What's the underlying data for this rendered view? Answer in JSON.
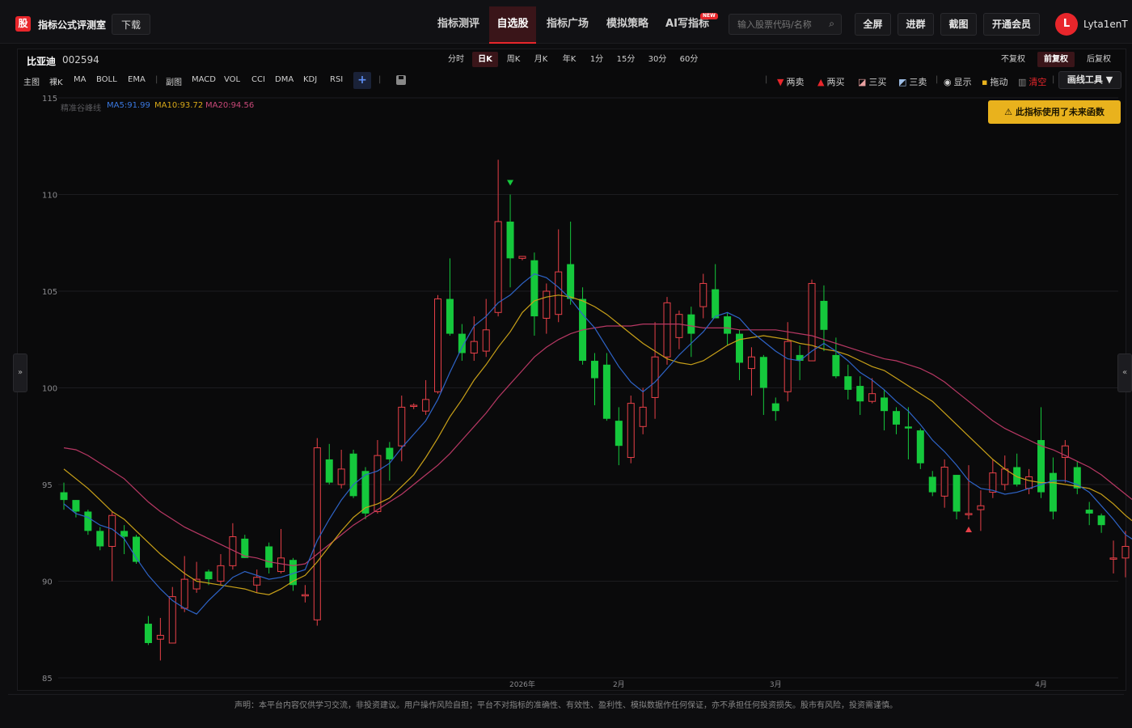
{
  "brand": {
    "logo_char": "股",
    "name": "指标公式评测室"
  },
  "header": {
    "download_label": "下载",
    "nav_tabs": [
      {
        "label": "指标测评"
      },
      {
        "label": "自选股"
      },
      {
        "label": "指标广场"
      },
      {
        "label": "模拟策略"
      },
      {
        "label": "AI写指标"
      }
    ],
    "active_tab": "自选股",
    "new_badge": "NEW",
    "search": {
      "placeholder": "输入股票代码/名称",
      "value": ""
    },
    "buttons": {
      "fullscreen": "全屏",
      "join_group": "进群",
      "screenshot": "截图",
      "vip": "开通会员"
    },
    "user": {
      "avatar_char": "L",
      "name": "Lyta1enT"
    },
    "accent_color": "#e8262b"
  },
  "stock": {
    "name": "比亚迪",
    "code": "002594"
  },
  "periods": [
    "分时",
    "日K",
    "周K",
    "月K",
    "年K",
    "1分",
    "15分",
    "30分",
    "60分"
  ],
  "active_period": "日K",
  "adjustments": [
    "不复权",
    "前复权",
    "后复权"
  ],
  "active_adjustment": "前复权",
  "indicators": {
    "main_label": "主图",
    "main": [
      "裸K",
      "MA",
      "BOLL",
      "EMA"
    ],
    "sub_label": "副图",
    "sub": [
      "MACD",
      "VOL",
      "CCI",
      "DMA",
      "KDJ",
      "RSI"
    ],
    "add": "+"
  },
  "tools": {
    "two_sell": "两卖",
    "two_buy": "两买",
    "three_buy": "三买",
    "three_sell": "三卖",
    "show": "显示",
    "drag": "拖动",
    "clear": "清空",
    "draw_tools": "画线工具",
    "warning": "此指标使用了未来函数"
  },
  "side_tabs": {
    "left": "»",
    "right": "«"
  },
  "footer": "声明：本平台内容仅供学习交流，非投资建议。用户操作风险自担；平台不对指标的准确性、有效性、盈利性、模拟数据作任何保证，亦不承担任何投资损失。股市有风险，投资需谨慎。",
  "chart_data": {
    "type": "candlestick",
    "ylim": [
      85,
      115
    ],
    "y_ticks": [
      85,
      90,
      95,
      100,
      105,
      110,
      115
    ],
    "x_labels": [
      {
        "label": "2026年",
        "index": 38
      },
      {
        "label": "2月",
        "index": 46
      },
      {
        "label": "3月",
        "index": 59
      },
      {
        "label": "4月",
        "index": 81
      }
    ],
    "ma_legend": {
      "name": "精准谷峰线",
      "ma5": "MA5:91.99",
      "ma10": "MA10:93.72",
      "ma20": "MA20:94.56"
    },
    "colors": {
      "up": "#e84048",
      "down": "#15c83c",
      "ma5": "#2e64c8",
      "ma10": "#c8a018",
      "ma20": "#b83864",
      "grid": "#1c1c20"
    },
    "candles": [
      [
        94.6,
        94.2,
        95.1,
        93.7
      ],
      [
        94.2,
        93.6,
        94.2,
        93.3
      ],
      [
        93.6,
        92.6,
        93.7,
        92.4
      ],
      [
        92.6,
        91.8,
        92.8,
        91.6
      ],
      [
        91.8,
        93.4,
        93.6,
        90.0
      ],
      [
        92.6,
        92.3,
        92.9,
        91.4
      ],
      [
        92.3,
        91.0,
        92.4,
        90.9
      ],
      [
        87.8,
        86.8,
        88.2,
        86.7
      ],
      [
        87.0,
        87.2,
        88.1,
        85.9
      ],
      [
        86.8,
        89.2,
        89.7,
        86.8
      ],
      [
        88.6,
        90.1,
        91.3,
        88.4
      ],
      [
        89.6,
        90.1,
        91.0,
        89.4
      ],
      [
        90.5,
        90.1,
        90.6,
        89.8
      ],
      [
        90.0,
        90.8,
        91.4,
        89.8
      ],
      [
        90.8,
        92.3,
        93.0,
        90.6
      ],
      [
        92.2,
        91.2,
        92.4,
        91.2
      ],
      [
        89.8,
        90.2,
        90.6,
        89.4
      ],
      [
        91.8,
        90.7,
        92.0,
        90.4
      ],
      [
        90.5,
        91.2,
        92.7,
        90.4
      ],
      [
        91.1,
        89.8,
        91.2,
        89.5
      ],
      [
        89.3,
        89.3,
        89.8,
        88.9
      ],
      [
        88.0,
        96.9,
        97.4,
        87.7
      ],
      [
        96.3,
        95.1,
        97.1,
        95.0
      ],
      [
        95.0,
        95.8,
        96.8,
        94.8
      ],
      [
        96.6,
        94.4,
        96.8,
        94.3
      ],
      [
        95.7,
        93.5,
        95.9,
        93.2
      ],
      [
        93.6,
        96.5,
        97.3,
        93.5
      ],
      [
        96.9,
        96.3,
        97.2,
        95.2
      ],
      [
        97.0,
        99.0,
        99.6,
        96.2
      ],
      [
        99.1,
        99.1,
        99.2,
        98.9
      ],
      [
        98.8,
        99.4,
        100.4,
        98.6
      ],
      [
        99.8,
        104.6,
        104.8,
        99.7
      ],
      [
        104.6,
        102.8,
        106.7,
        102.7
      ],
      [
        102.8,
        101.8,
        103.3,
        101.4
      ],
      [
        101.8,
        102.4,
        103.7,
        101.4
      ],
      [
        101.9,
        103.0,
        104.6,
        101.6
      ],
      [
        103.9,
        108.6,
        111.8,
        103.7
      ],
      [
        108.6,
        106.7,
        110.0,
        105.2
      ],
      [
        106.7,
        106.8,
        106.8,
        106.6
      ],
      [
        106.6,
        103.7,
        107.0,
        102.7
      ],
      [
        103.6,
        105.0,
        105.4,
        102.8
      ],
      [
        103.8,
        106.0,
        108.2,
        103.4
      ],
      [
        106.4,
        104.6,
        108.6,
        104.3
      ],
      [
        104.6,
        101.4,
        105.2,
        101.2
      ],
      [
        101.4,
        100.5,
        101.8,
        99.1
      ],
      [
        101.2,
        98.4,
        101.8,
        98.3
      ],
      [
        98.3,
        97.0,
        99.0,
        96.0
      ],
      [
        96.4,
        99.2,
        99.6,
        96.1
      ],
      [
        98.0,
        99.0,
        100.0,
        97.6
      ],
      [
        99.5,
        101.6,
        103.4,
        98.4
      ],
      [
        101.6,
        104.4,
        104.7,
        101.2
      ],
      [
        102.6,
        103.8,
        104.0,
        102.0
      ],
      [
        103.8,
        102.8,
        104.2,
        101.6
      ],
      [
        104.2,
        105.4,
        105.9,
        103.6
      ],
      [
        105.1,
        103.6,
        106.4,
        103.6
      ],
      [
        103.7,
        102.8,
        103.9,
        102.2
      ],
      [
        102.8,
        101.3,
        103.0,
        100.4
      ],
      [
        101.0,
        101.6,
        102.1,
        99.6
      ],
      [
        101.6,
        100.0,
        101.7,
        98.6
      ],
      [
        99.2,
        98.8,
        99.5,
        98.3
      ],
      [
        99.8,
        102.4,
        103.4,
        99.3
      ],
      [
        101.7,
        101.4,
        102.2,
        100.4
      ],
      [
        101.4,
        105.4,
        105.6,
        101.4
      ],
      [
        104.5,
        103.0,
        105.3,
        101.9
      ],
      [
        101.7,
        100.6,
        102.6,
        100.5
      ],
      [
        100.6,
        99.9,
        101.2,
        99.4
      ],
      [
        100.1,
        99.3,
        100.6,
        98.6
      ],
      [
        99.3,
        99.7,
        100.5,
        99.2
      ],
      [
        99.5,
        98.8,
        99.9,
        97.8
      ],
      [
        98.8,
        98.1,
        99.0,
        97.6
      ],
      [
        98.0,
        97.9,
        99.0,
        96.3
      ],
      [
        97.8,
        96.1,
        97.9,
        95.8
      ],
      [
        95.4,
        94.6,
        95.7,
        94.4
      ],
      [
        94.4,
        95.9,
        96.3,
        93.8
      ],
      [
        95.5,
        93.6,
        95.5,
        93.2
      ],
      [
        93.5,
        93.5,
        96.0,
        93.2
      ],
      [
        93.7,
        93.9,
        94.7,
        92.6
      ],
      [
        94.6,
        95.6,
        96.3,
        94.3
      ],
      [
        95.0,
        95.8,
        96.5,
        94.7
      ],
      [
        95.9,
        95.0,
        96.6,
        94.9
      ],
      [
        94.8,
        95.4,
        95.8,
        94.5
      ],
      [
        97.3,
        94.6,
        99.0,
        94.3
      ],
      [
        95.6,
        93.6,
        96.4,
        93.2
      ],
      [
        96.4,
        97.0,
        97.3,
        95.1
      ],
      [
        95.9,
        94.8,
        96.2,
        94.5
      ],
      [
        93.7,
        93.5,
        94.1,
        92.9
      ],
      [
        93.4,
        92.9,
        93.5,
        92.5
      ],
      [
        91.2,
        91.2,
        92.1,
        90.4
      ],
      [
        91.2,
        91.8,
        92.6,
        90.2
      ],
      [
        91.0,
        90.4,
        91.1,
        90.2
      ]
    ],
    "ma5": [
      94.0,
      93.5,
      93.3,
      92.9,
      92.7,
      92.2,
      91.2,
      90.3,
      89.6,
      89.0,
      88.6,
      88.3,
      89.0,
      89.6,
      90.2,
      90.5,
      90.3,
      90.1,
      90.2,
      90.4,
      90.6,
      92.1,
      93.2,
      94.2,
      95.0,
      95.5,
      95.7,
      96.1,
      96.9,
      97.6,
      98.3,
      99.4,
      100.8,
      102.1,
      103.2,
      103.7,
      104.4,
      104.8,
      105.4,
      105.9,
      105.7,
      105.2,
      104.6,
      103.8,
      103.1,
      102.1,
      101.1,
      100.3,
      99.8,
      100.3,
      101.0,
      101.7,
      102.3,
      102.9,
      103.7,
      103.9,
      103.6,
      102.9,
      102.4,
      101.9,
      101.5,
      101.4,
      101.9,
      102.3,
      101.9,
      101.4,
      100.8,
      100.4,
      99.9,
      99.3,
      98.8,
      98.1,
      97.3,
      96.7,
      96.0,
      95.2,
      94.8,
      94.7,
      94.5,
      94.6,
      94.8,
      95.0,
      95.2,
      95.2,
      95.0,
      94.6,
      93.9,
      93.2,
      92.4,
      92.0
    ],
    "ma10": [
      95.8,
      95.3,
      94.8,
      94.2,
      93.6,
      93.2,
      92.6,
      92.0,
      91.4,
      90.9,
      90.4,
      90.0,
      89.9,
      89.8,
      89.7,
      89.6,
      89.4,
      89.3,
      89.6,
      90.0,
      90.3,
      91.0,
      91.8,
      92.6,
      93.3,
      93.8,
      94.0,
      94.3,
      94.9,
      95.5,
      96.4,
      97.4,
      98.5,
      99.4,
      100.4,
      101.2,
      102.1,
      102.9,
      103.9,
      104.5,
      104.7,
      104.8,
      104.7,
      104.5,
      104.2,
      103.8,
      103.3,
      102.8,
      102.3,
      101.9,
      101.5,
      101.3,
      101.2,
      101.4,
      101.8,
      102.2,
      102.5,
      102.6,
      102.7,
      102.6,
      102.5,
      102.3,
      102.2,
      102.0,
      101.9,
      101.7,
      101.4,
      101.1,
      100.9,
      100.5,
      100.1,
      99.7,
      99.3,
      98.7,
      98.1,
      97.5,
      96.9,
      96.3,
      95.8,
      95.4,
      95.2,
      95.1,
      95.1,
      95.0,
      94.9,
      94.8,
      94.5,
      94.0,
      93.4,
      92.9
    ],
    "ma20": [
      96.9,
      96.8,
      96.5,
      96.1,
      95.7,
      95.3,
      94.7,
      94.1,
      93.6,
      93.2,
      92.8,
      92.5,
      92.2,
      91.9,
      91.6,
      91.3,
      91.2,
      91.0,
      90.9,
      90.8,
      90.9,
      91.4,
      91.9,
      92.4,
      92.9,
      93.3,
      93.7,
      94.1,
      94.5,
      95.0,
      95.5,
      96.0,
      96.6,
      97.3,
      98.0,
      98.7,
      99.5,
      100.2,
      100.9,
      101.6,
      102.1,
      102.5,
      102.8,
      103.0,
      103.1,
      103.2,
      103.2,
      103.2,
      103.3,
      103.3,
      103.3,
      103.3,
      103.2,
      103.1,
      103.1,
      103.1,
      103.0,
      103.0,
      103.0,
      103.0,
      102.9,
      102.8,
      102.7,
      102.5,
      102.3,
      102.1,
      101.9,
      101.7,
      101.5,
      101.4,
      101.2,
      101.0,
      100.7,
      100.3,
      99.8,
      99.3,
      98.8,
      98.3,
      97.9,
      97.6,
      97.3,
      97.0,
      96.8,
      96.5,
      96.2,
      95.9,
      95.5,
      95.0,
      94.5,
      94.0
    ],
    "signals": [
      {
        "type": "sell",
        "index": 37
      },
      {
        "type": "buy",
        "index": 75
      }
    ]
  }
}
